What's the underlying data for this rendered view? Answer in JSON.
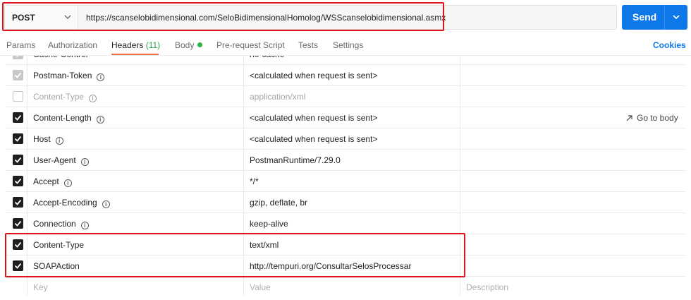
{
  "request": {
    "method": "POST",
    "url": "https://scanselobidimensional.com/SeloBidimensionalHomolog/WSScanselobidimensional.asmx",
    "send_label": "Send"
  },
  "tabs": [
    {
      "label": "Params"
    },
    {
      "label": "Authorization"
    },
    {
      "label": "Headers",
      "count": "(11)"
    },
    {
      "label": "Body"
    },
    {
      "label": "Pre-request Script"
    },
    {
      "label": "Tests"
    },
    {
      "label": "Settings"
    }
  ],
  "cookies_label": "Cookies",
  "goto_label": "Go to body",
  "headers": [
    {
      "key": "Cache-Control",
      "value": "no-cache"
    },
    {
      "key": "Postman-Token",
      "value": "<calculated when request is sent>"
    },
    {
      "key": "Content-Type",
      "value": "application/xml"
    },
    {
      "key": "Content-Length",
      "value": "<calculated when request is sent>"
    },
    {
      "key": "Host",
      "value": "<calculated when request is sent>"
    },
    {
      "key": "User-Agent",
      "value": "PostmanRuntime/7.29.0"
    },
    {
      "key": "Accept",
      "value": "*/*"
    },
    {
      "key": "Accept-Encoding",
      "value": "gzip, deflate, br"
    },
    {
      "key": "Connection",
      "value": "keep-alive"
    },
    {
      "key": "Content-Type",
      "value": "text/xml"
    },
    {
      "key": "SOAPAction",
      "value": "http://tempuri.org/ConsultarSelosProcessar"
    }
  ],
  "new_row": {
    "key": "Key",
    "value": "Value",
    "description": "Description"
  },
  "colors": {
    "accent": "#0f78e8",
    "highlight": "#e0141e",
    "active_tab": "#f26b3a"
  }
}
